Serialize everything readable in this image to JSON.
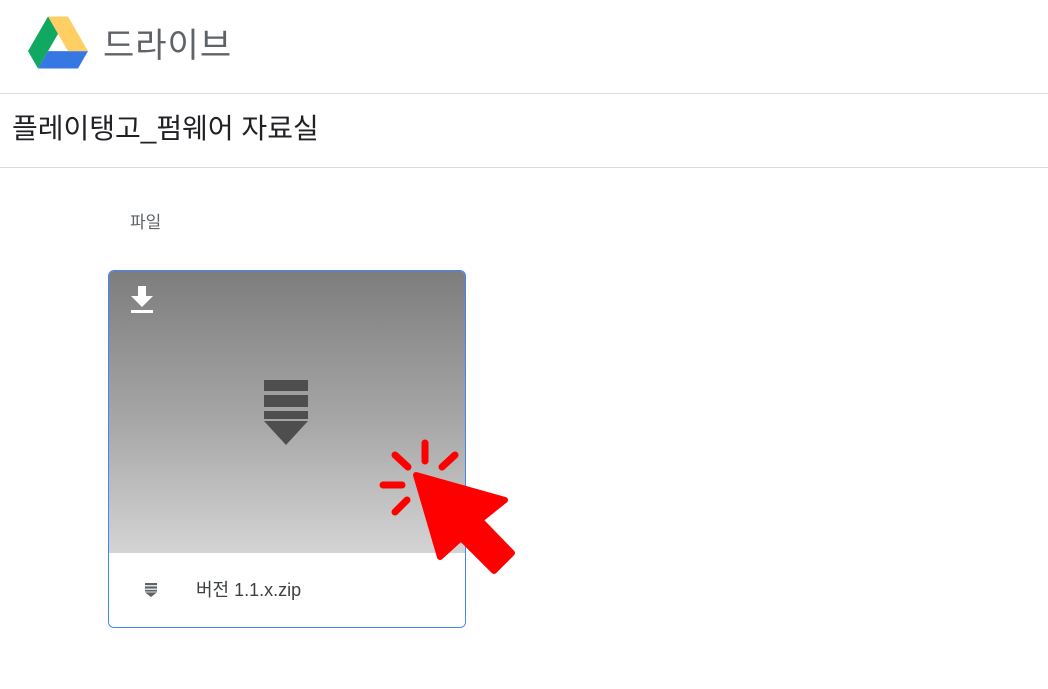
{
  "app": {
    "name": "드라이브"
  },
  "folder": {
    "title": "플레이탱고_펌웨어 자료실"
  },
  "section": {
    "label": "파일"
  },
  "files": [
    {
      "name": "버전 1.1.x.zip",
      "type_icon": "zip-icon",
      "action_icon": "download-icon"
    }
  ],
  "icons": {
    "logo": "google-drive-logo-icon",
    "overlay": "click-cursor-icon"
  },
  "colors": {
    "card_border": "#4285f4",
    "header_text": "#5f6368",
    "divider": "#dadce0",
    "overlay": "#ff0000",
    "logo_blue": "#3777e3",
    "logo_yellow": "#ffcf63",
    "logo_green": "#11a861"
  }
}
